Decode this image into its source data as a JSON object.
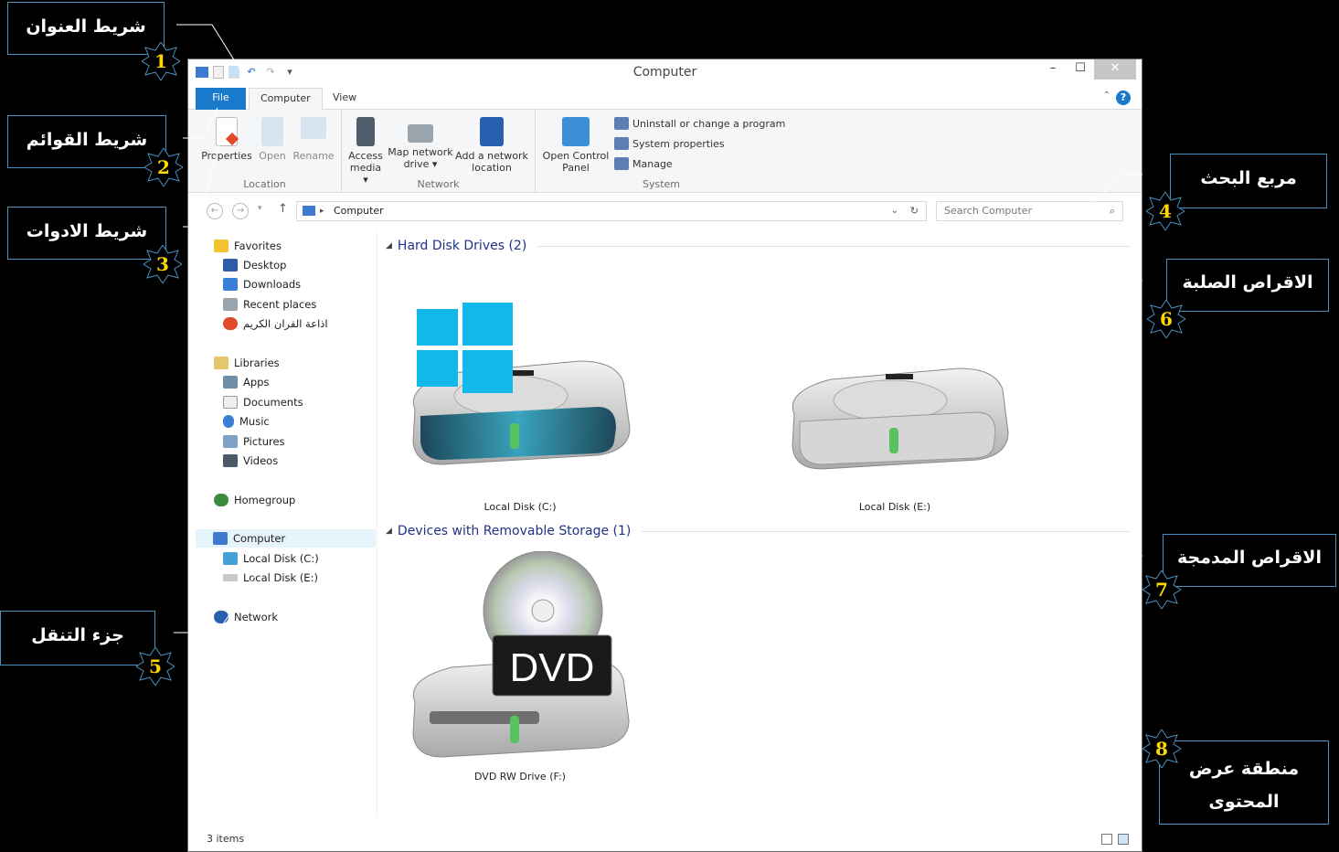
{
  "window": {
    "title": "Computer",
    "qat_dropdown": "▾",
    "min": "–",
    "max": "☐",
    "close": "✕"
  },
  "tabs": {
    "file": "File",
    "computer": "Computer",
    "view": "View",
    "help": "?"
  },
  "ribbon": {
    "location": {
      "label": "Location",
      "properties": "Properties",
      "open": "Open",
      "rename": "Rename"
    },
    "network": {
      "label": "Network",
      "access_media": "Access media ▾",
      "map_drive": "Map network drive ▾",
      "add_location": "Add a network location"
    },
    "system": {
      "label": "System",
      "open_control_panel": "Open Control Panel",
      "uninstall": "Uninstall or change a program",
      "system_properties": "System properties",
      "manage": "Manage"
    }
  },
  "address": {
    "path": "Computer",
    "search_placeholder": "Search Computer"
  },
  "nav": {
    "favorites": "Favorites",
    "desktop": "Desktop",
    "downloads": "Downloads",
    "recent": "Recent places",
    "quran": "اذاعة القران الكريم",
    "libraries": "Libraries",
    "apps": "Apps",
    "documents": "Documents",
    "music": "Music",
    "pictures": "Pictures",
    "videos": "Videos",
    "homegroup": "Homegroup",
    "computer": "Computer",
    "disk_c": "Local Disk (C:)",
    "disk_e": "Local Disk (E:)",
    "network": "Network"
  },
  "content": {
    "hdd_group": "Hard Disk Drives (2)",
    "removable_group": "Devices with Removable Storage (1)",
    "drives": [
      "Local Disk (C:)",
      "Local Disk (E:)",
      "DVD RW Drive (F:)"
    ],
    "dvd_logo": "DVD"
  },
  "status": {
    "items": "3 items"
  },
  "callouts": {
    "c1": {
      "num": "1",
      "text": "شريط العنوان"
    },
    "c2": {
      "num": "2",
      "text": "شريط القوائم"
    },
    "c3": {
      "num": "3",
      "text": "شريط الادوات"
    },
    "c4": {
      "num": "4",
      "text": "مربع البحث"
    },
    "c5": {
      "num": "5",
      "text": "جزء التنقل"
    },
    "c6": {
      "num": "6",
      "text": "الاقراص الصلبة"
    },
    "c7": {
      "num": "7",
      "text": "الاقراص المدمجة"
    },
    "c8": {
      "num": "8",
      "text": "منطقة عرض المحتوى"
    }
  },
  "colors": {
    "accent": "#1979ca",
    "group_header": "#1e3287",
    "badge_number": "#ffd800",
    "callout_border": "#4a90c0"
  }
}
